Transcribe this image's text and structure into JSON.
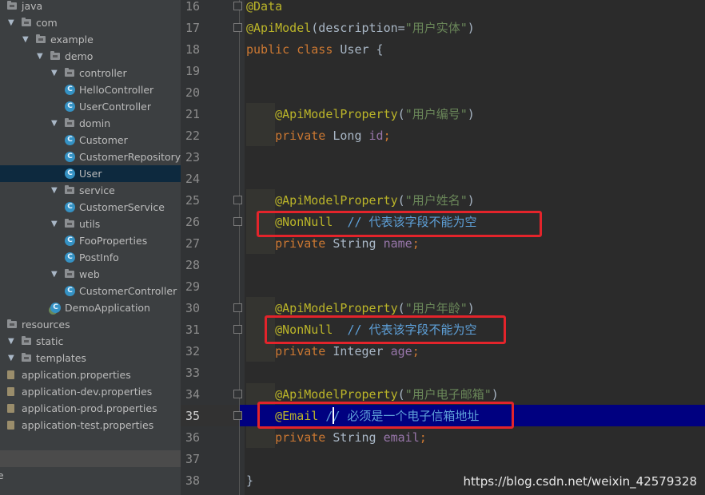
{
  "tree": {
    "items": [
      {
        "label": "java",
        "kind": "folder",
        "depth": 0
      },
      {
        "label": "com",
        "kind": "folder",
        "depth": 1
      },
      {
        "label": "example",
        "kind": "folder",
        "depth": 2
      },
      {
        "label": "demo",
        "kind": "folder",
        "depth": 3
      },
      {
        "label": "controller",
        "kind": "folder",
        "depth": 4
      },
      {
        "label": "HelloController",
        "kind": "class",
        "depth": 5
      },
      {
        "label": "UserController",
        "kind": "class",
        "depth": 5
      },
      {
        "label": "domin",
        "kind": "folder",
        "depth": 4
      },
      {
        "label": "Customer",
        "kind": "class",
        "depth": 5
      },
      {
        "label": "CustomerRepository",
        "kind": "class",
        "depth": 5
      },
      {
        "label": "User",
        "kind": "class",
        "depth": 5,
        "selected": true
      },
      {
        "label": "service",
        "kind": "folder",
        "depth": 4
      },
      {
        "label": "CustomerService",
        "kind": "class",
        "depth": 5
      },
      {
        "label": "utils",
        "kind": "folder",
        "depth": 4
      },
      {
        "label": "FooProperties",
        "kind": "class",
        "depth": 5
      },
      {
        "label": "PostInfo",
        "kind": "class",
        "depth": 5
      },
      {
        "label": "web",
        "kind": "folder",
        "depth": 4
      },
      {
        "label": "CustomerController",
        "kind": "class",
        "depth": 5
      },
      {
        "label": "DemoApplication",
        "kind": "app",
        "depth": 4
      },
      {
        "label": "resources",
        "kind": "folder",
        "depth": 0
      },
      {
        "label": "static",
        "kind": "folder",
        "depth": 1
      },
      {
        "label": "templates",
        "kind": "folder",
        "depth": 1
      },
      {
        "label": "application.properties",
        "kind": "props",
        "depth": 1
      },
      {
        "label": "application-dev.properties",
        "kind": "props",
        "depth": 1
      },
      {
        "label": "application-prod.properties",
        "kind": "props",
        "depth": 1
      },
      {
        "label": "application-test.properties",
        "kind": "props",
        "depth": 1
      },
      {
        "label": "",
        "kind": "blank",
        "depth": 0
      },
      {
        "label": "",
        "kind": "hover",
        "depth": 0
      },
      {
        "label": "re",
        "kind": "text",
        "depth": 0
      }
    ]
  },
  "editor": {
    "current_line": 35,
    "lines": [
      {
        "n": "16",
        "tokens": [
          [
            "anno",
            "@Data"
          ]
        ]
      },
      {
        "n": "17",
        "tokens": [
          [
            "anno",
            "@ApiModel"
          ],
          [
            "plain",
            "(description="
          ],
          [
            "str",
            "\"用户实体\""
          ],
          [
            "plain",
            ")"
          ]
        ]
      },
      {
        "n": "18",
        "tokens": [
          [
            "kw",
            "public class "
          ],
          [
            "plain",
            "User {"
          ]
        ]
      },
      {
        "n": "19",
        "tokens": []
      },
      {
        "n": "20",
        "tokens": []
      },
      {
        "n": "21",
        "tokens": [
          [
            "plain",
            "    "
          ],
          [
            "anno",
            "@ApiModelProperty"
          ],
          [
            "plain",
            "("
          ],
          [
            "str",
            "\"用户编号\""
          ],
          [
            "plain",
            ")"
          ]
        ]
      },
      {
        "n": "22",
        "tokens": [
          [
            "plain",
            "    "
          ],
          [
            "kw",
            "private "
          ],
          [
            "plain",
            "Long "
          ],
          [
            "field",
            "id"
          ],
          [
            "kw",
            ";"
          ]
        ]
      },
      {
        "n": "23",
        "tokens": []
      },
      {
        "n": "24",
        "tokens": []
      },
      {
        "n": "25",
        "tokens": [
          [
            "plain",
            "    "
          ],
          [
            "anno",
            "@ApiModelProperty"
          ],
          [
            "plain",
            "("
          ],
          [
            "str",
            "\"用户姓名\""
          ],
          [
            "plain",
            ")"
          ]
        ]
      },
      {
        "n": "26",
        "tokens": [
          [
            "plain",
            "    "
          ],
          [
            "anno",
            "@NonNull"
          ],
          [
            "plain",
            "  "
          ],
          [
            "cmt-b",
            "// 代表该字段不能为空"
          ]
        ]
      },
      {
        "n": "27",
        "tokens": [
          [
            "plain",
            "    "
          ],
          [
            "kw",
            "private "
          ],
          [
            "plain",
            "String "
          ],
          [
            "field",
            "name"
          ],
          [
            "kw",
            ";"
          ]
        ]
      },
      {
        "n": "28",
        "tokens": []
      },
      {
        "n": "29",
        "tokens": []
      },
      {
        "n": "30",
        "tokens": [
          [
            "plain",
            "    "
          ],
          [
            "anno",
            "@ApiModelProperty"
          ],
          [
            "plain",
            "("
          ],
          [
            "str",
            "\"用户年龄\""
          ],
          [
            "plain",
            ")"
          ]
        ]
      },
      {
        "n": "31",
        "tokens": [
          [
            "plain",
            "    "
          ],
          [
            "anno",
            "@NonNull"
          ],
          [
            "plain",
            "  "
          ],
          [
            "cmt-b",
            "// 代表该字段不能为空"
          ]
        ]
      },
      {
        "n": "32",
        "tokens": [
          [
            "plain",
            "    "
          ],
          [
            "kw",
            "private "
          ],
          [
            "plain",
            "Integer "
          ],
          [
            "field",
            "age"
          ],
          [
            "kw",
            ";"
          ]
        ]
      },
      {
        "n": "33",
        "tokens": []
      },
      {
        "n": "34",
        "tokens": [
          [
            "plain",
            "    "
          ],
          [
            "anno",
            "@ApiModelProperty"
          ],
          [
            "plain",
            "("
          ],
          [
            "str",
            "\"用户电子邮箱\""
          ],
          [
            "plain",
            ")"
          ]
        ]
      },
      {
        "n": "35",
        "tokens": [
          [
            "plain",
            "    "
          ],
          [
            "anno",
            "@Email"
          ],
          [
            "plain",
            " "
          ],
          [
            "cmt-b",
            "// 必须是一个电子信箱地址"
          ]
        ]
      },
      {
        "n": "36",
        "tokens": [
          [
            "plain",
            "    "
          ],
          [
            "kw",
            "private "
          ],
          [
            "plain",
            "String "
          ],
          [
            "field",
            "email"
          ],
          [
            "kw",
            ";"
          ]
        ]
      },
      {
        "n": "37",
        "tokens": []
      },
      {
        "n": "38",
        "tokens": [
          [
            "plain",
            "}"
          ]
        ]
      }
    ]
  },
  "watermark": "https://blog.csdn.net/weixin_42579328",
  "colors": {
    "annotation": "#bbb529",
    "keyword": "#cc7832",
    "string": "#6a8759",
    "field": "#9876aa",
    "comment": "#5ea0d8",
    "highlight_box": "#e3242b",
    "current_line_bg": "#000080"
  }
}
